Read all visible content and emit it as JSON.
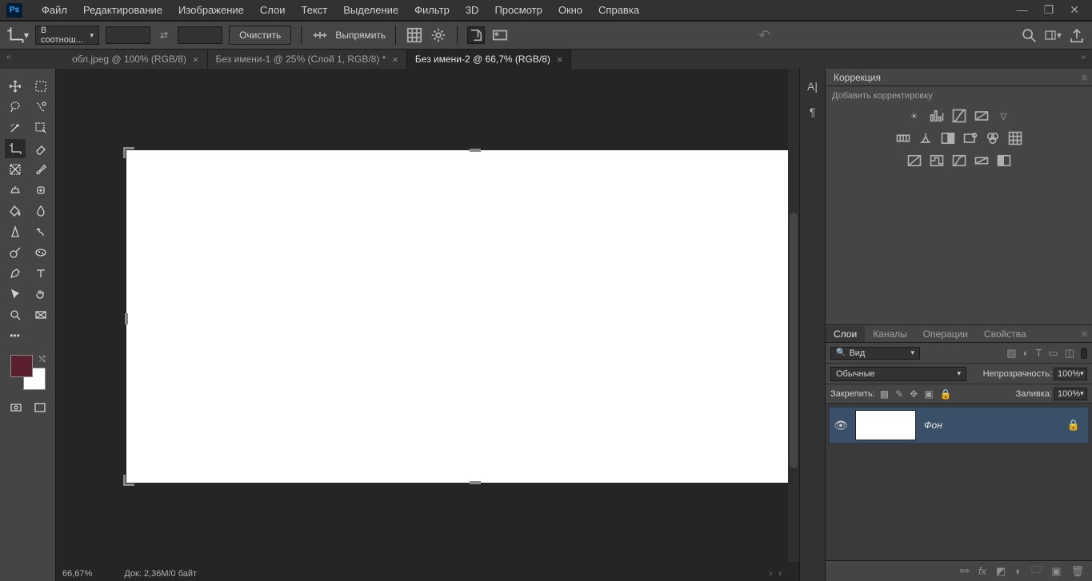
{
  "app": {
    "logo": "Ps"
  },
  "menu": {
    "file": "Файл",
    "edit": "Редактирование",
    "image": "Изображение",
    "layer": "Слои",
    "type": "Текст",
    "select": "Выделение",
    "filter": "Фильтр",
    "threeD": "3D",
    "view": "Просмотр",
    "window": "Окно",
    "help": "Справка"
  },
  "options": {
    "ratio_dd": "В соотнош...",
    "clear_btn": "Очистить",
    "straighten": "Выпрямить"
  },
  "tabs": [
    {
      "label": "обл.jpeg @ 100% (RGB/8)"
    },
    {
      "label": "Без имени-1 @ 25% (Слой 1, RGB/8) *"
    },
    {
      "label": "Без имени-2 @ 66,7% (RGB/8)"
    }
  ],
  "active_tab_index": 2,
  "colors": {
    "fg": "#5a2030",
    "bg": "#ffffff"
  },
  "corrections": {
    "tab": "Коррекция",
    "hint": "Добавить корректировку"
  },
  "layers_panel": {
    "tabs": {
      "layers": "Слои",
      "channels": "Каналы",
      "actions": "Операции",
      "properties": "Свойства"
    },
    "filter": "Вид",
    "blend_mode": "Обычные",
    "opacity_label": "Непрозрачность:",
    "opacity_value": "100%",
    "lock_label": "Закрепить:",
    "fill_label": "Заливка:",
    "fill_value": "100%",
    "layer_name": "Фон"
  },
  "status": {
    "zoom": "66,67%",
    "doc": "Док: 2,36М/0 байт"
  }
}
